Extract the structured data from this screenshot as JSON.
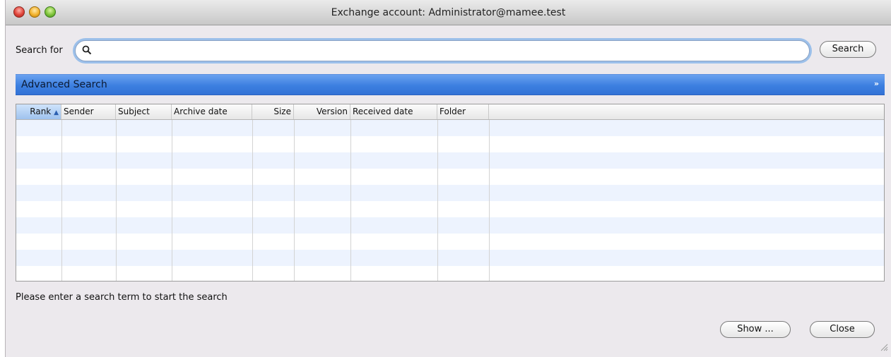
{
  "window": {
    "title": "Exchange account: Administrator@mamee.test"
  },
  "search": {
    "label": "Search for",
    "value": "",
    "placeholder": "",
    "button": "Search"
  },
  "advanced": {
    "label": "Advanced Search",
    "chevron": "»"
  },
  "table": {
    "columns": [
      {
        "label": "Rank",
        "sorted": true,
        "sort_dir": "▲"
      },
      {
        "label": "Sender"
      },
      {
        "label": "Subject"
      },
      {
        "label": "Archive date"
      },
      {
        "label": "Size"
      },
      {
        "label": "Version"
      },
      {
        "label": "Received date"
      },
      {
        "label": "Folder"
      },
      {
        "label": ""
      }
    ],
    "rows": []
  },
  "status": {
    "message": "Please enter a search term to start the search"
  },
  "buttons": {
    "show": "Show ...",
    "close": "Close"
  },
  "colors": {
    "accent": "#3c7fe0",
    "row_alt": "#edf3fe",
    "focus_ring": "#9cc0ea"
  }
}
